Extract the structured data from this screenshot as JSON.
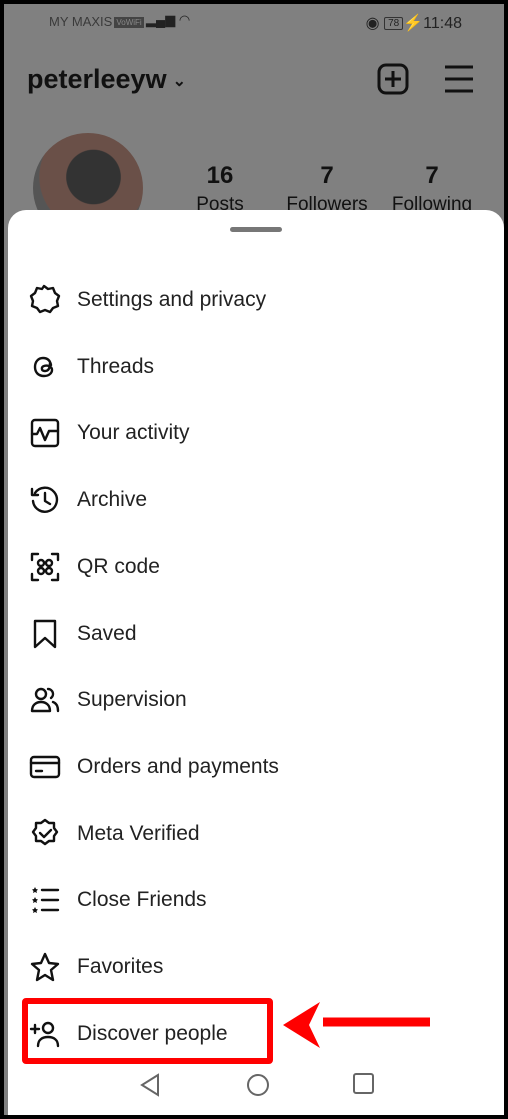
{
  "status_bar": {
    "carrier": "MY MAXIS",
    "vowifi": "VoWiFi",
    "signal": "signal-icon",
    "wifi": "wifi-icon",
    "battery": "78",
    "time": "11:48"
  },
  "profile": {
    "username": "peterleeyw",
    "stats": [
      {
        "value": "16",
        "label": "Posts"
      },
      {
        "value": "7",
        "label": "Followers"
      },
      {
        "value": "7",
        "label": "Following"
      }
    ]
  },
  "menu": {
    "items": [
      {
        "label": "Settings and privacy",
        "icon": "gear-icon"
      },
      {
        "label": "Threads",
        "icon": "threads-icon"
      },
      {
        "label": "Your activity",
        "icon": "activity-icon"
      },
      {
        "label": "Archive",
        "icon": "archive-icon"
      },
      {
        "label": "QR code",
        "icon": "qr-code-icon"
      },
      {
        "label": "Saved",
        "icon": "bookmark-icon"
      },
      {
        "label": "Supervision",
        "icon": "supervision-icon"
      },
      {
        "label": "Orders and payments",
        "icon": "credit-card-icon"
      },
      {
        "label": "Meta Verified",
        "icon": "verified-badge-icon"
      },
      {
        "label": "Close Friends",
        "icon": "close-friends-icon"
      },
      {
        "label": "Favorites",
        "icon": "star-icon"
      },
      {
        "label": "Discover people",
        "icon": "add-person-icon"
      }
    ]
  },
  "annotation": {
    "color": "#ff0000",
    "highlighted_item": "Discover people"
  }
}
